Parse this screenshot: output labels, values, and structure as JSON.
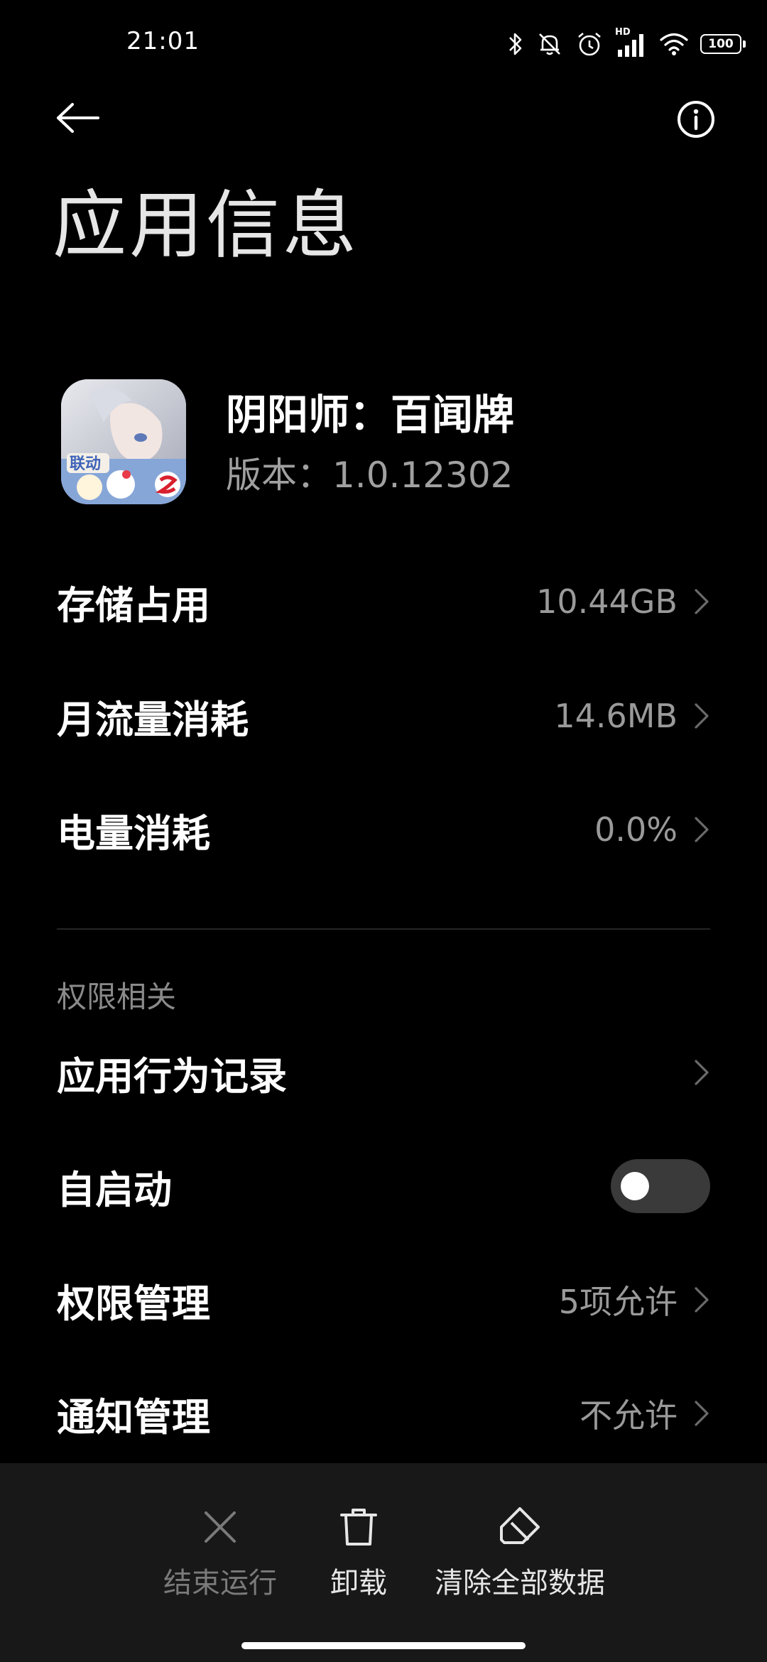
{
  "status_bar": {
    "time": "21:01",
    "hd_label": "HD",
    "battery": "100",
    "icons": [
      "bluetooth-icon",
      "silent-icon",
      "alarm-icon",
      "signal-icon",
      "wifi-icon",
      "battery-icon"
    ]
  },
  "toolbar": {
    "back_icon": "back-arrow-icon",
    "info_icon": "info-icon"
  },
  "page_title": "应用信息",
  "app": {
    "name": "阴阳师：百闻牌",
    "version": "版本：1.0.12302",
    "icon_badge": "联动"
  },
  "rows": {
    "storage": {
      "label": "存储占用",
      "value": "10.44GB"
    },
    "traffic": {
      "label": "月流量消耗",
      "value": "14.6MB"
    },
    "battery": {
      "label": "电量消耗",
      "value": "0.0%"
    }
  },
  "permissions": {
    "section_title": "权限相关",
    "behavior": {
      "label": "应用行为记录"
    },
    "autostart": {
      "label": "自启动",
      "enabled": false
    },
    "manage": {
      "label": "权限管理",
      "value": "5项允许"
    },
    "notify": {
      "label": "通知管理",
      "value": "不允许"
    }
  },
  "actions": {
    "stop": {
      "label": "结束运行",
      "icon": "close-icon",
      "enabled": false
    },
    "uninstall": {
      "label": "卸载",
      "icon": "trash-icon",
      "enabled": true
    },
    "clear": {
      "label": "清除全部数据",
      "icon": "eraser-icon",
      "enabled": true
    }
  },
  "colors": {
    "background": "#000000",
    "bottom_bar": "#181818",
    "secondary_text": "#9a9a9a",
    "disabled_text": "#7a7a7a"
  }
}
